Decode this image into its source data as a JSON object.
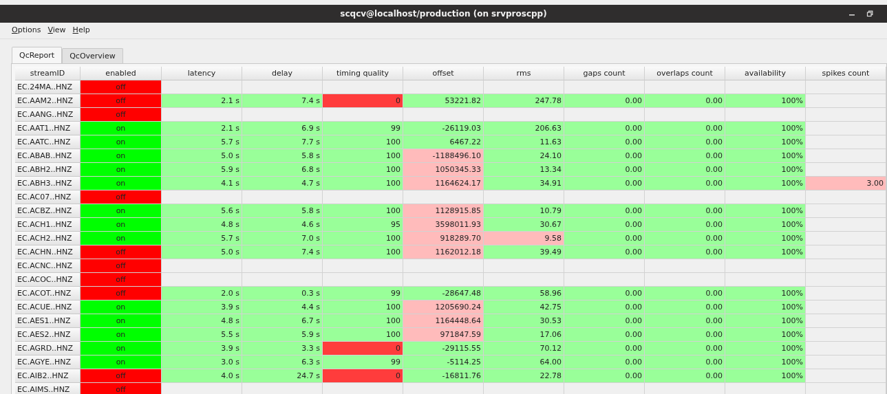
{
  "window": {
    "title": "scqcv@localhost/production (on srvproscpp)"
  },
  "menu": [
    "Options",
    "View",
    "Help"
  ],
  "tabs": [
    {
      "label": "QcReport",
      "selected": true
    },
    {
      "label": "QcOverview",
      "selected": false
    }
  ],
  "table": {
    "columns": [
      "streamID",
      "enabled",
      "latency",
      "delay",
      "timing quality",
      "offset",
      "rms",
      "gaps count",
      "overlaps count",
      "availability",
      "spikes count"
    ],
    "rows": [
      {
        "stream": "EC.24MA..HNZ",
        "enabled": {
          "text": "off",
          "color": "#ff0000"
        }
      },
      {
        "stream": "EC.AAM2..HNZ",
        "enabled": {
          "text": "off",
          "color": "#ff0000"
        },
        "values": [
          {
            "text": "2.1 s",
            "color": "#99ff99"
          },
          {
            "text": "7.4 s",
            "color": "#99ff99"
          },
          {
            "text": "0",
            "color": "#ff3c3c"
          },
          {
            "text": "53221.82",
            "color": "#99ff99"
          },
          {
            "text": "247.78",
            "color": "#99ff99"
          },
          {
            "text": "0.00",
            "color": "#99ff99"
          },
          {
            "text": "0.00",
            "color": "#99ff99"
          },
          {
            "text": "100%",
            "color": "#99ff99"
          }
        ]
      },
      {
        "stream": "EC.AANG..HNZ",
        "enabled": {
          "text": "off",
          "color": "#ff0000"
        }
      },
      {
        "stream": "EC.AAT1..HNZ",
        "enabled": {
          "text": "on",
          "color": "#00ff00"
        },
        "values": [
          {
            "text": "2.1 s",
            "color": "#99ff99"
          },
          {
            "text": "6.9 s",
            "color": "#99ff99"
          },
          {
            "text": "99",
            "color": "#99ff99"
          },
          {
            "text": "-26119.03",
            "color": "#99ff99"
          },
          {
            "text": "206.63",
            "color": "#99ff99"
          },
          {
            "text": "0.00",
            "color": "#99ff99"
          },
          {
            "text": "0.00",
            "color": "#99ff99"
          },
          {
            "text": "100%",
            "color": "#99ff99"
          }
        ]
      },
      {
        "stream": "EC.AATC..HNZ",
        "enabled": {
          "text": "on",
          "color": "#00ff00"
        },
        "values": [
          {
            "text": "5.7 s",
            "color": "#99ff99"
          },
          {
            "text": "7.7 s",
            "color": "#99ff99"
          },
          {
            "text": "100",
            "color": "#99ff99"
          },
          {
            "text": "6467.22",
            "color": "#99ff99"
          },
          {
            "text": "11.63",
            "color": "#99ff99"
          },
          {
            "text": "0.00",
            "color": "#99ff99"
          },
          {
            "text": "0.00",
            "color": "#99ff99"
          },
          {
            "text": "100%",
            "color": "#99ff99"
          }
        ]
      },
      {
        "stream": "EC.ABAB..HNZ",
        "enabled": {
          "text": "on",
          "color": "#00ff00"
        },
        "values": [
          {
            "text": "5.0 s",
            "color": "#99ff99"
          },
          {
            "text": "5.8 s",
            "color": "#99ff99"
          },
          {
            "text": "100",
            "color": "#99ff99"
          },
          {
            "text": "-1188496.10",
            "color": "#ffbbbb"
          },
          {
            "text": "24.10",
            "color": "#99ff99"
          },
          {
            "text": "0.00",
            "color": "#99ff99"
          },
          {
            "text": "0.00",
            "color": "#99ff99"
          },
          {
            "text": "100%",
            "color": "#99ff99"
          }
        ]
      },
      {
        "stream": "EC.ABH2..HNZ",
        "enabled": {
          "text": "on",
          "color": "#00ff00"
        },
        "values": [
          {
            "text": "5.9 s",
            "color": "#99ff99"
          },
          {
            "text": "6.8 s",
            "color": "#99ff99"
          },
          {
            "text": "100",
            "color": "#99ff99"
          },
          {
            "text": "1050345.33",
            "color": "#ffbbbb"
          },
          {
            "text": "13.34",
            "color": "#99ff99"
          },
          {
            "text": "0.00",
            "color": "#99ff99"
          },
          {
            "text": "0.00",
            "color": "#99ff99"
          },
          {
            "text": "100%",
            "color": "#99ff99"
          }
        ]
      },
      {
        "stream": "EC.ABH3..HNZ",
        "enabled": {
          "text": "on",
          "color": "#00ff00"
        },
        "values": [
          {
            "text": "4.1 s",
            "color": "#99ff99"
          },
          {
            "text": "4.7 s",
            "color": "#99ff99"
          },
          {
            "text": "100",
            "color": "#99ff99"
          },
          {
            "text": "1164624.17",
            "color": "#ffbbbb"
          },
          {
            "text": "34.91",
            "color": "#99ff99"
          },
          {
            "text": "0.00",
            "color": "#99ff99"
          },
          {
            "text": "0.00",
            "color": "#99ff99"
          },
          {
            "text": "100%",
            "color": "#99ff99"
          }
        ],
        "spikes": {
          "text": "3.00",
          "color": "#ffbbbb"
        }
      },
      {
        "stream": "EC.AC07..HNZ",
        "enabled": {
          "text": "off",
          "color": "#ff0000"
        }
      },
      {
        "stream": "EC.ACBZ..HNZ",
        "enabled": {
          "text": "on",
          "color": "#00ff00"
        },
        "values": [
          {
            "text": "5.6 s",
            "color": "#99ff99"
          },
          {
            "text": "5.8 s",
            "color": "#99ff99"
          },
          {
            "text": "100",
            "color": "#99ff99"
          },
          {
            "text": "1128915.85",
            "color": "#ffbbbb"
          },
          {
            "text": "10.79",
            "color": "#99ff99"
          },
          {
            "text": "0.00",
            "color": "#99ff99"
          },
          {
            "text": "0.00",
            "color": "#99ff99"
          },
          {
            "text": "100%",
            "color": "#99ff99"
          }
        ]
      },
      {
        "stream": "EC.ACH1..HNZ",
        "enabled": {
          "text": "on",
          "color": "#00ff00"
        },
        "values": [
          {
            "text": "4.8 s",
            "color": "#99ff99"
          },
          {
            "text": "4.6 s",
            "color": "#99ff99"
          },
          {
            "text": "95",
            "color": "#99ff99"
          },
          {
            "text": "3598011.93",
            "color": "#ffbbbb"
          },
          {
            "text": "30.67",
            "color": "#99ff99"
          },
          {
            "text": "0.00",
            "color": "#99ff99"
          },
          {
            "text": "0.00",
            "color": "#99ff99"
          },
          {
            "text": "100%",
            "color": "#99ff99"
          }
        ]
      },
      {
        "stream": "EC.ACH2..HNZ",
        "enabled": {
          "text": "on",
          "color": "#00ff00"
        },
        "values": [
          {
            "text": "5.7 s",
            "color": "#99ff99"
          },
          {
            "text": "7.0 s",
            "color": "#99ff99"
          },
          {
            "text": "100",
            "color": "#99ff99"
          },
          {
            "text": "918289.70",
            "color": "#ffbbbb"
          },
          {
            "text": "9.58",
            "color": "#ffbbbb"
          },
          {
            "text": "0.00",
            "color": "#99ff99"
          },
          {
            "text": "0.00",
            "color": "#99ff99"
          },
          {
            "text": "100%",
            "color": "#99ff99"
          }
        ]
      },
      {
        "stream": "EC.ACHN..HNZ",
        "enabled": {
          "text": "off",
          "color": "#ff0000"
        },
        "values": [
          {
            "text": "5.0 s",
            "color": "#99ff99"
          },
          {
            "text": "7.4 s",
            "color": "#99ff99"
          },
          {
            "text": "100",
            "color": "#99ff99"
          },
          {
            "text": "1162012.18",
            "color": "#ffbbbb"
          },
          {
            "text": "39.49",
            "color": "#99ff99"
          },
          {
            "text": "0.00",
            "color": "#99ff99"
          },
          {
            "text": "0.00",
            "color": "#99ff99"
          },
          {
            "text": "100%",
            "color": "#99ff99"
          }
        ]
      },
      {
        "stream": "EC.ACNC..HNZ",
        "enabled": {
          "text": "off",
          "color": "#ff0000"
        }
      },
      {
        "stream": "EC.ACOC..HNZ",
        "enabled": {
          "text": "off",
          "color": "#ff0000"
        }
      },
      {
        "stream": "EC.ACOT..HNZ",
        "enabled": {
          "text": "off",
          "color": "#ff0000"
        },
        "values": [
          {
            "text": "2.0 s",
            "color": "#99ff99"
          },
          {
            "text": "0.3 s",
            "color": "#99ff99"
          },
          {
            "text": "99",
            "color": "#99ff99"
          },
          {
            "text": "-28647.48",
            "color": "#99ff99"
          },
          {
            "text": "58.96",
            "color": "#99ff99"
          },
          {
            "text": "0.00",
            "color": "#99ff99"
          },
          {
            "text": "0.00",
            "color": "#99ff99"
          },
          {
            "text": "100%",
            "color": "#99ff99"
          }
        ]
      },
      {
        "stream": "EC.ACUE..HNZ",
        "enabled": {
          "text": "on",
          "color": "#00ff00"
        },
        "values": [
          {
            "text": "3.9 s",
            "color": "#99ff99"
          },
          {
            "text": "4.4 s",
            "color": "#99ff99"
          },
          {
            "text": "100",
            "color": "#99ff99"
          },
          {
            "text": "1205690.24",
            "color": "#ffbbbb"
          },
          {
            "text": "42.75",
            "color": "#99ff99"
          },
          {
            "text": "0.00",
            "color": "#99ff99"
          },
          {
            "text": "0.00",
            "color": "#99ff99"
          },
          {
            "text": "100%",
            "color": "#99ff99"
          }
        ]
      },
      {
        "stream": "EC.AES1..HNZ",
        "enabled": {
          "text": "on",
          "color": "#00ff00"
        },
        "values": [
          {
            "text": "4.8 s",
            "color": "#99ff99"
          },
          {
            "text": "6.7 s",
            "color": "#99ff99"
          },
          {
            "text": "100",
            "color": "#99ff99"
          },
          {
            "text": "1164448.64",
            "color": "#ffbbbb"
          },
          {
            "text": "30.53",
            "color": "#99ff99"
          },
          {
            "text": "0.00",
            "color": "#99ff99"
          },
          {
            "text": "0.00",
            "color": "#99ff99"
          },
          {
            "text": "100%",
            "color": "#99ff99"
          }
        ]
      },
      {
        "stream": "EC.AES2..HNZ",
        "enabled": {
          "text": "on",
          "color": "#00ff00"
        },
        "values": [
          {
            "text": "5.5 s",
            "color": "#99ff99"
          },
          {
            "text": "5.9 s",
            "color": "#99ff99"
          },
          {
            "text": "100",
            "color": "#99ff99"
          },
          {
            "text": "971847.59",
            "color": "#ffbbbb"
          },
          {
            "text": "17.06",
            "color": "#99ff99"
          },
          {
            "text": "0.00",
            "color": "#99ff99"
          },
          {
            "text": "0.00",
            "color": "#99ff99"
          },
          {
            "text": "100%",
            "color": "#99ff99"
          }
        ]
      },
      {
        "stream": "EC.AGRD..HNZ",
        "enabled": {
          "text": "on",
          "color": "#00ff00"
        },
        "values": [
          {
            "text": "3.9 s",
            "color": "#99ff99"
          },
          {
            "text": "3.3 s",
            "color": "#99ff99"
          },
          {
            "text": "0",
            "color": "#ff3c3c"
          },
          {
            "text": "-29115.55",
            "color": "#99ff99"
          },
          {
            "text": "70.12",
            "color": "#99ff99"
          },
          {
            "text": "0.00",
            "color": "#99ff99"
          },
          {
            "text": "0.00",
            "color": "#99ff99"
          },
          {
            "text": "100%",
            "color": "#99ff99"
          }
        ]
      },
      {
        "stream": "EC.AGYE..HNZ",
        "enabled": {
          "text": "on",
          "color": "#00ff00"
        },
        "values": [
          {
            "text": "3.0 s",
            "color": "#99ff99"
          },
          {
            "text": "6.3 s",
            "color": "#99ff99"
          },
          {
            "text": "99",
            "color": "#99ff99"
          },
          {
            "text": "-5114.25",
            "color": "#99ff99"
          },
          {
            "text": "64.00",
            "color": "#99ff99"
          },
          {
            "text": "0.00",
            "color": "#99ff99"
          },
          {
            "text": "0.00",
            "color": "#99ff99"
          },
          {
            "text": "100%",
            "color": "#99ff99"
          }
        ]
      },
      {
        "stream": "EC.AIB2..HNZ",
        "enabled": {
          "text": "off",
          "color": "#ff0000"
        },
        "values": [
          {
            "text": "4.0 s",
            "color": "#99ff99"
          },
          {
            "text": "24.7 s",
            "color": "#99ff99"
          },
          {
            "text": "0",
            "color": "#ff3c3c"
          },
          {
            "text": "-16811.76",
            "color": "#99ff99"
          },
          {
            "text": "22.78",
            "color": "#99ff99"
          },
          {
            "text": "0.00",
            "color": "#99ff99"
          },
          {
            "text": "0.00",
            "color": "#99ff99"
          },
          {
            "text": "100%",
            "color": "#99ff99"
          }
        ]
      },
      {
        "stream": "EC.AIMS..HNZ",
        "enabled": {
          "text": "off",
          "color": "#ff0000"
        }
      }
    ]
  }
}
